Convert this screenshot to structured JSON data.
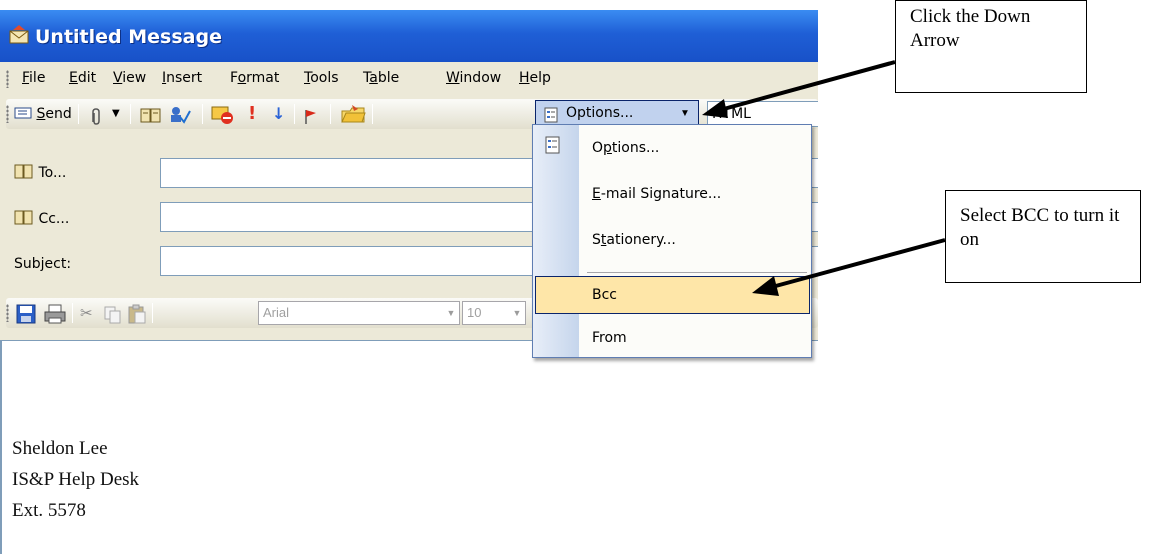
{
  "window": {
    "title": "Untitled Message",
    "accent": "#1f5fd6"
  },
  "menubar": {
    "items": [
      "File",
      "Edit",
      "View",
      "Insert",
      "Format",
      "Tools",
      "Table",
      "Window",
      "Help"
    ]
  },
  "toolbar": {
    "send_label": "Send",
    "options_label": "Options...",
    "format_value": "HTML"
  },
  "fields": {
    "to_label": "To...",
    "cc_label": "Cc...",
    "subject_label": "Subject:",
    "to_value": "",
    "cc_value": "",
    "subject_value": ""
  },
  "format_toolbar": {
    "font": "Arial",
    "size": "10"
  },
  "options_menu": {
    "items": [
      "Options...",
      "E-mail Signature...",
      "Stationery...",
      "Bcc",
      "From"
    ],
    "highlighted": "Bcc",
    "highlight_color": "#fee6a8"
  },
  "body": {
    "signature_lines": [
      "Sheldon Lee",
      "IS&P Help Desk",
      "Ext. 5578"
    ]
  },
  "callouts": {
    "top": "Click the Down Arrow",
    "right": "Select BCC to turn it on"
  },
  "icons": [
    "envelope-icon",
    "send-icon",
    "paperclip-icon",
    "address-book-icon",
    "check-names-icon",
    "permission-icon",
    "high-importance-icon",
    "low-importance-icon",
    "flag-icon",
    "folder-icon",
    "options-icon",
    "save-icon",
    "print-icon",
    "cut-icon",
    "copy-icon",
    "paste-icon"
  ]
}
